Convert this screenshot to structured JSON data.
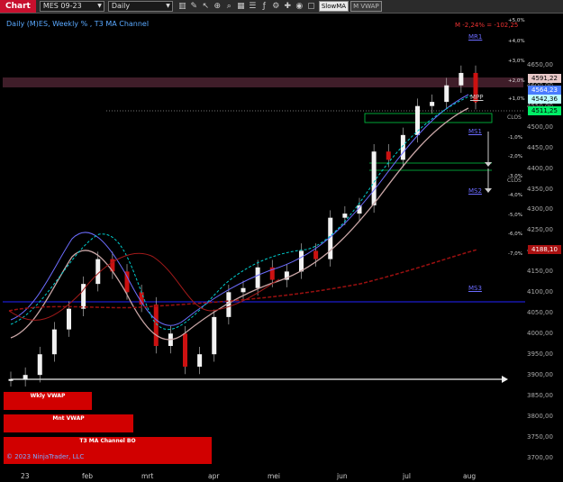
{
  "toolbar": {
    "chart_label": "Chart",
    "instrument": "MES 09-23",
    "period": "Daily",
    "btn_slowma": "SlowMA",
    "btn_mvwap": "M VWAP"
  },
  "chart": {
    "title": "Daily (M)ES, Weekly % , T3 MA Channel",
    "copyright": "© 2023 NinjaTrader, LLC",
    "m_label": "M -2,24% = -102,25",
    "y_ticks": [
      "4650,00",
      "4600,00",
      "4550,00",
      "4500,00",
      "4450,00",
      "4400,00",
      "4350,00",
      "4300,00",
      "4250,00",
      "4200,00",
      "4150,00",
      "4100,00",
      "4050,00",
      "4000,00",
      "3950,00",
      "3900,00",
      "3850,00",
      "3800,00",
      "3750,00",
      "3700,00"
    ],
    "y_range": [
      3700,
      4680
    ],
    "pct_levels": [
      "+5,0%",
      "+4,0%",
      "+3,0%",
      "+2,0%",
      "+1,0%",
      "-1,0%",
      "-2,0%",
      "-3,0%",
      "-4,0%",
      "-5,0%",
      "-6,0%",
      "-7,0%"
    ],
    "x_labels": [
      "23",
      "feb",
      "mrt",
      "apr",
      "mei",
      "jun",
      "jul",
      "aug"
    ],
    "pivots": [
      "MR1",
      "MPP",
      "MS1",
      "MS2",
      "MS3"
    ],
    "close_label": "CLOS",
    "price_tags": [
      {
        "value": "4591,22",
        "color": "#e8c8c8"
      },
      {
        "value": "4564,23",
        "color": "#4a7cff"
      },
      {
        "value": "4542,36",
        "color": "#bff"
      },
      {
        "value": "4511,25",
        "color": "#00ee66"
      },
      {
        "value": "4188,10",
        "color": "#aa1111"
      }
    ],
    "vwap_boxes": [
      "Wkly VWAP",
      "Mnt VWAP",
      "T3 MA Channel BO"
    ]
  },
  "chart_data": {
    "type": "line",
    "series": [
      {
        "name": "price",
        "values": [
          3890,
          3900,
          3950,
          4010,
          4060,
          4120,
          4180,
          4150,
          4100,
          4070,
          3970,
          4000,
          3920,
          3950,
          4040,
          4100,
          4110,
          4160,
          4130,
          4150,
          4200,
          4180,
          4280,
          4290,
          4310,
          4440,
          4420,
          4480,
          4550,
          4560,
          4600,
          4630,
          4560
        ]
      }
    ]
  }
}
